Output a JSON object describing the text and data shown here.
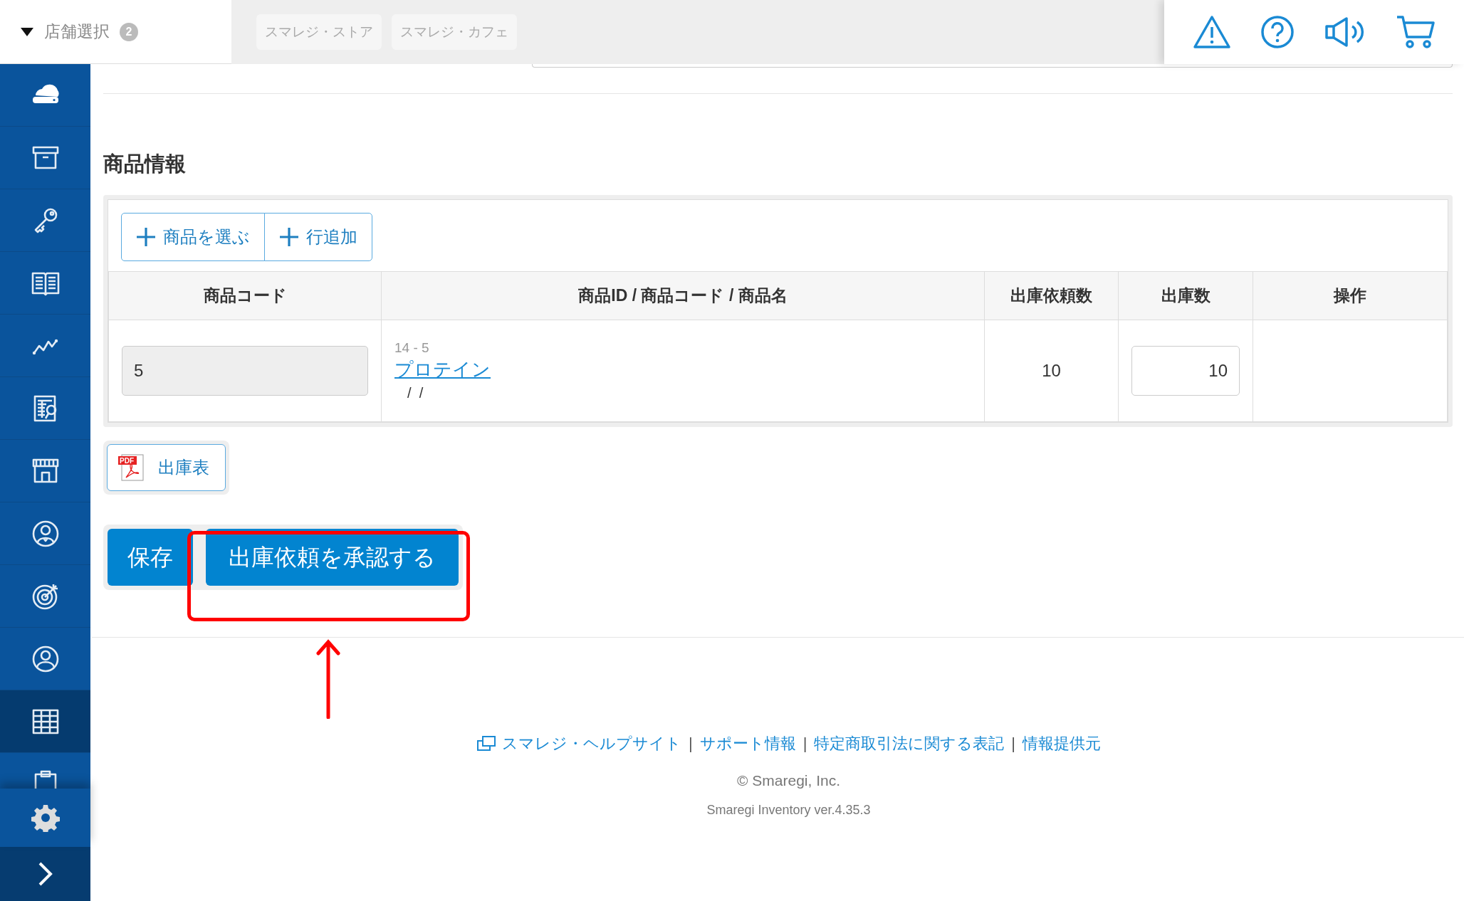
{
  "store_selector": {
    "label": "店舗選択",
    "badge": "2"
  },
  "store_tabs": [
    {
      "label": "スマレジ・ストア"
    },
    {
      "label": "スマレジ・カフェ"
    }
  ],
  "sidebar": {
    "items": [
      {
        "selected": false
      },
      {
        "selected": false
      },
      {
        "selected": false
      },
      {
        "selected": false
      },
      {
        "selected": false
      },
      {
        "selected": false
      },
      {
        "selected": false
      },
      {
        "selected": false
      },
      {
        "selected": false
      },
      {
        "selected": false
      },
      {
        "selected": true
      },
      {
        "selected": false
      }
    ]
  },
  "section_title": "商品情報",
  "toolbar": [
    "商品を選ぶ",
    "行追加"
  ],
  "table": {
    "columns": [
      "商品コード",
      "商品ID / 商品コード / 商品名",
      "出庫依頼数",
      "出庫数",
      "操作"
    ],
    "rows": [
      {
        "code": "5",
        "code_disabled": true,
        "product_id": "14 - 5",
        "product_name": "プロテイン",
        "product_sub": "/  /",
        "requested_qty": "10",
        "shipped_qty": "10"
      }
    ]
  },
  "pdf_button": {
    "label": "出庫表",
    "icon_text": "PDF"
  },
  "actions": {
    "save": "保存",
    "approve": "出庫依頼を承認する"
  },
  "footer": {
    "items": [
      {
        "kind": "link",
        "label": "スマレジ・ヘルプサイト",
        "external": true
      },
      {
        "kind": "separator",
        "label": "|"
      },
      {
        "kind": "link",
        "label": "サポート情報",
        "external": false
      },
      {
        "kind": "separator",
        "label": "|"
      },
      {
        "kind": "link",
        "label": "特定商取引法に関する表記",
        "external": false
      },
      {
        "kind": "separator",
        "label": "|"
      },
      {
        "kind": "link",
        "label": "情報提供元",
        "external": false
      }
    ],
    "copyright": "© Smaregi, Inc.",
    "version": "Smaregi Inventory ver.4.35.3"
  }
}
